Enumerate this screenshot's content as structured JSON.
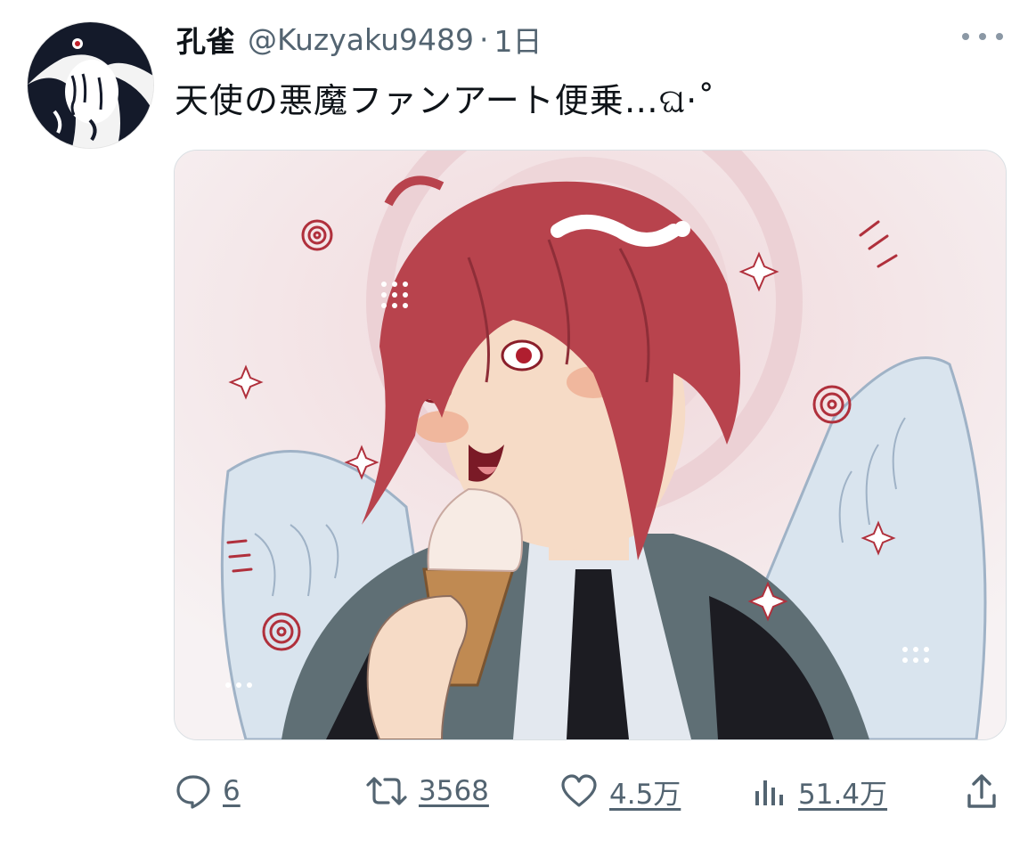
{
  "tweet": {
    "display_name": "孔雀",
    "handle": "@Kuzyaku9489",
    "separator": "·",
    "time": "1日",
    "text": "天使の悪魔ファンアート便乗…ଘ·˚"
  },
  "actions": {
    "reply_count": "6",
    "retweet_count": "3568",
    "like_count": "4.5万",
    "views_count": "51.4万"
  },
  "icons": {
    "more": "more-horizontal-icon",
    "reply": "speech-bubble-icon",
    "retweet": "retweet-arrows-icon",
    "like": "heart-icon",
    "views": "bar-chart-icon",
    "share": "upload-icon"
  },
  "colors": {
    "text_primary": "#0f1419",
    "text_secondary": "#536471",
    "hair_red": "#b8434d",
    "suit_gray": "#5f6f75"
  }
}
